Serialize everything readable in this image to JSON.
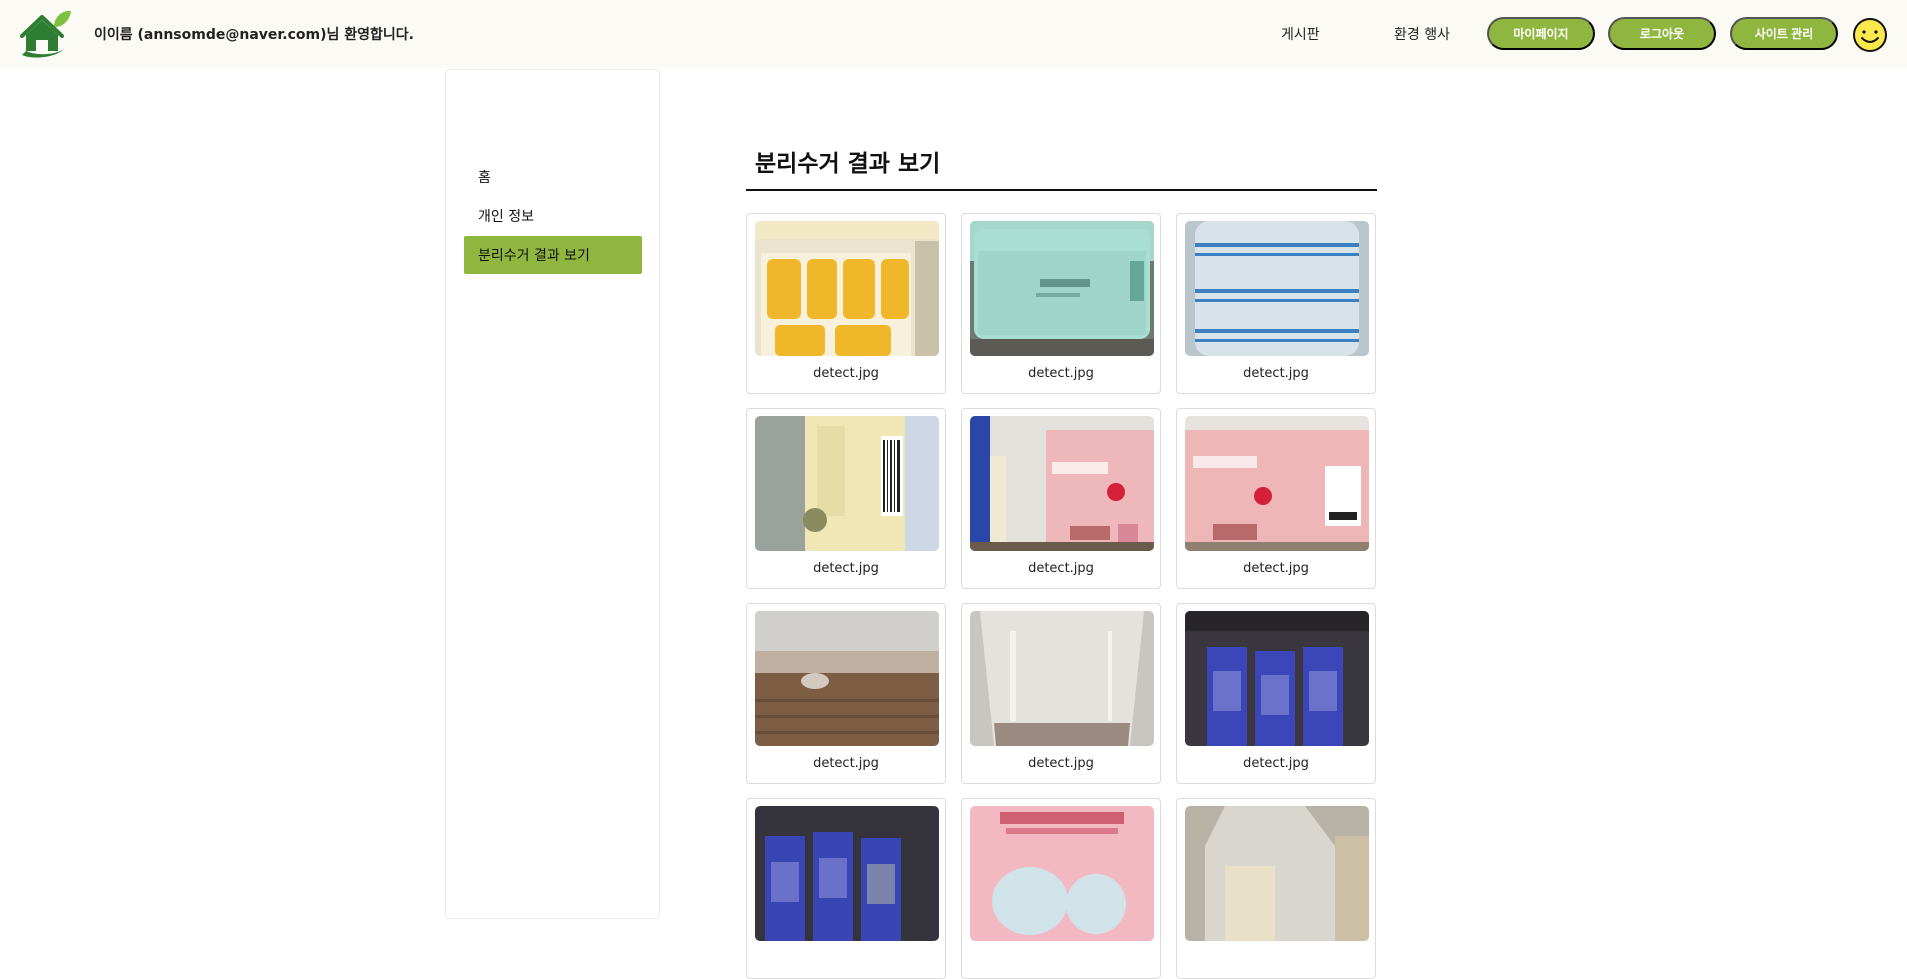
{
  "header": {
    "welcome": "이이름 (annsomde@naver.com)님 환영합니다.",
    "nav": {
      "board": "게시판",
      "event": "환경 행사"
    },
    "buttons": {
      "mypage": "마이페이지",
      "logout": "로그아웃",
      "admin": "사이트 관리"
    },
    "accent_color": "#8fb63f"
  },
  "sidebar": {
    "items": [
      {
        "label": "홈",
        "active": false
      },
      {
        "label": "개인 정보",
        "active": false
      },
      {
        "label": "분리수거 결과 보기",
        "active": true
      }
    ]
  },
  "main": {
    "title": "분리수거 결과 보기",
    "results": [
      {
        "filename": "detect.jpg",
        "photo": "banana milk carton"
      },
      {
        "filename": "detect.jpg",
        "photo": "mint cosmetic jar"
      },
      {
        "filename": "detect.jpg",
        "photo": "plastic water bottle"
      },
      {
        "filename": "detect.jpg",
        "photo": "carton barcode label"
      },
      {
        "filename": "detect.jpg",
        "photo": "eye palette box"
      },
      {
        "filename": "detect.jpg",
        "photo": "eye palette box"
      },
      {
        "filename": "detect.jpg",
        "photo": "clear plastic lid"
      },
      {
        "filename": "detect.jpg",
        "photo": "clear plastic cup"
      },
      {
        "filename": "detect.jpg",
        "photo": "blue bottles blurred"
      },
      {
        "filename": "detect.jpg",
        "photo": "blue bottles blurred"
      },
      {
        "filename": "detect.jpg",
        "photo": "liquid mask box"
      },
      {
        "filename": "detect.jpg",
        "photo": "pump bottle"
      }
    ]
  }
}
